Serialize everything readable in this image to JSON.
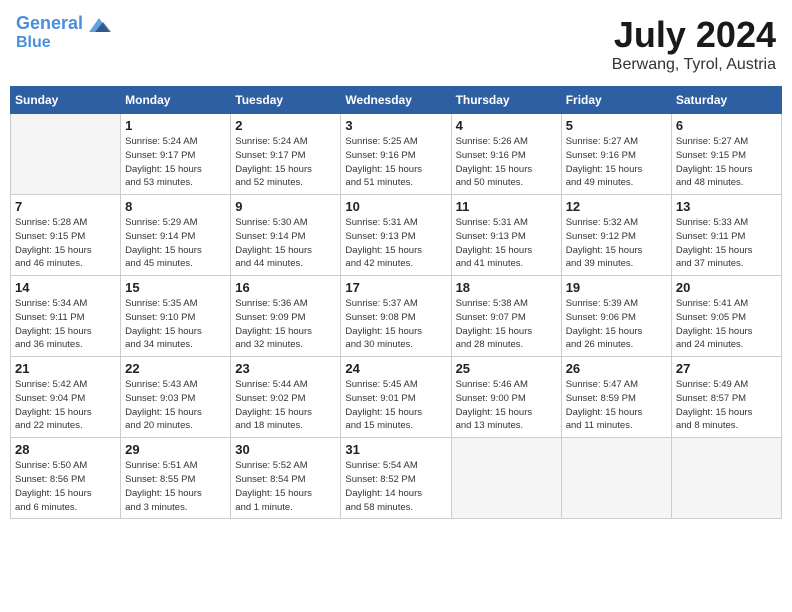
{
  "header": {
    "logo_line1": "General",
    "logo_line2": "Blue",
    "month_title": "July 2024",
    "location": "Berwang, Tyrol, Austria"
  },
  "weekdays": [
    "Sunday",
    "Monday",
    "Tuesday",
    "Wednesday",
    "Thursday",
    "Friday",
    "Saturday"
  ],
  "weeks": [
    [
      {
        "day": "",
        "info": ""
      },
      {
        "day": "1",
        "info": "Sunrise: 5:24 AM\nSunset: 9:17 PM\nDaylight: 15 hours\nand 53 minutes."
      },
      {
        "day": "2",
        "info": "Sunrise: 5:24 AM\nSunset: 9:17 PM\nDaylight: 15 hours\nand 52 minutes."
      },
      {
        "day": "3",
        "info": "Sunrise: 5:25 AM\nSunset: 9:16 PM\nDaylight: 15 hours\nand 51 minutes."
      },
      {
        "day": "4",
        "info": "Sunrise: 5:26 AM\nSunset: 9:16 PM\nDaylight: 15 hours\nand 50 minutes."
      },
      {
        "day": "5",
        "info": "Sunrise: 5:27 AM\nSunset: 9:16 PM\nDaylight: 15 hours\nand 49 minutes."
      },
      {
        "day": "6",
        "info": "Sunrise: 5:27 AM\nSunset: 9:15 PM\nDaylight: 15 hours\nand 48 minutes."
      }
    ],
    [
      {
        "day": "7",
        "info": "Sunrise: 5:28 AM\nSunset: 9:15 PM\nDaylight: 15 hours\nand 46 minutes."
      },
      {
        "day": "8",
        "info": "Sunrise: 5:29 AM\nSunset: 9:14 PM\nDaylight: 15 hours\nand 45 minutes."
      },
      {
        "day": "9",
        "info": "Sunrise: 5:30 AM\nSunset: 9:14 PM\nDaylight: 15 hours\nand 44 minutes."
      },
      {
        "day": "10",
        "info": "Sunrise: 5:31 AM\nSunset: 9:13 PM\nDaylight: 15 hours\nand 42 minutes."
      },
      {
        "day": "11",
        "info": "Sunrise: 5:31 AM\nSunset: 9:13 PM\nDaylight: 15 hours\nand 41 minutes."
      },
      {
        "day": "12",
        "info": "Sunrise: 5:32 AM\nSunset: 9:12 PM\nDaylight: 15 hours\nand 39 minutes."
      },
      {
        "day": "13",
        "info": "Sunrise: 5:33 AM\nSunset: 9:11 PM\nDaylight: 15 hours\nand 37 minutes."
      }
    ],
    [
      {
        "day": "14",
        "info": "Sunrise: 5:34 AM\nSunset: 9:11 PM\nDaylight: 15 hours\nand 36 minutes."
      },
      {
        "day": "15",
        "info": "Sunrise: 5:35 AM\nSunset: 9:10 PM\nDaylight: 15 hours\nand 34 minutes."
      },
      {
        "day": "16",
        "info": "Sunrise: 5:36 AM\nSunset: 9:09 PM\nDaylight: 15 hours\nand 32 minutes."
      },
      {
        "day": "17",
        "info": "Sunrise: 5:37 AM\nSunset: 9:08 PM\nDaylight: 15 hours\nand 30 minutes."
      },
      {
        "day": "18",
        "info": "Sunrise: 5:38 AM\nSunset: 9:07 PM\nDaylight: 15 hours\nand 28 minutes."
      },
      {
        "day": "19",
        "info": "Sunrise: 5:39 AM\nSunset: 9:06 PM\nDaylight: 15 hours\nand 26 minutes."
      },
      {
        "day": "20",
        "info": "Sunrise: 5:41 AM\nSunset: 9:05 PM\nDaylight: 15 hours\nand 24 minutes."
      }
    ],
    [
      {
        "day": "21",
        "info": "Sunrise: 5:42 AM\nSunset: 9:04 PM\nDaylight: 15 hours\nand 22 minutes."
      },
      {
        "day": "22",
        "info": "Sunrise: 5:43 AM\nSunset: 9:03 PM\nDaylight: 15 hours\nand 20 minutes."
      },
      {
        "day": "23",
        "info": "Sunrise: 5:44 AM\nSunset: 9:02 PM\nDaylight: 15 hours\nand 18 minutes."
      },
      {
        "day": "24",
        "info": "Sunrise: 5:45 AM\nSunset: 9:01 PM\nDaylight: 15 hours\nand 15 minutes."
      },
      {
        "day": "25",
        "info": "Sunrise: 5:46 AM\nSunset: 9:00 PM\nDaylight: 15 hours\nand 13 minutes."
      },
      {
        "day": "26",
        "info": "Sunrise: 5:47 AM\nSunset: 8:59 PM\nDaylight: 15 hours\nand 11 minutes."
      },
      {
        "day": "27",
        "info": "Sunrise: 5:49 AM\nSunset: 8:57 PM\nDaylight: 15 hours\nand 8 minutes."
      }
    ],
    [
      {
        "day": "28",
        "info": "Sunrise: 5:50 AM\nSunset: 8:56 PM\nDaylight: 15 hours\nand 6 minutes."
      },
      {
        "day": "29",
        "info": "Sunrise: 5:51 AM\nSunset: 8:55 PM\nDaylight: 15 hours\nand 3 minutes."
      },
      {
        "day": "30",
        "info": "Sunrise: 5:52 AM\nSunset: 8:54 PM\nDaylight: 15 hours\nand 1 minute."
      },
      {
        "day": "31",
        "info": "Sunrise: 5:54 AM\nSunset: 8:52 PM\nDaylight: 14 hours\nand 58 minutes."
      },
      {
        "day": "",
        "info": ""
      },
      {
        "day": "",
        "info": ""
      },
      {
        "day": "",
        "info": ""
      }
    ]
  ]
}
